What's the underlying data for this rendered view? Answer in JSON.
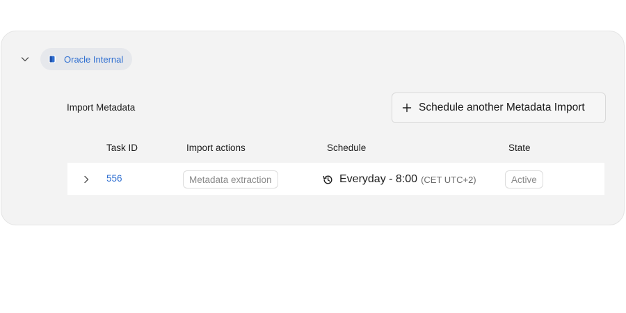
{
  "source": {
    "name": "Oracle Internal",
    "icon": "database-icon"
  },
  "section": {
    "title": "Import Metadata",
    "schedule_button": "Schedule another Metadata Import"
  },
  "table": {
    "columns": [
      "Task ID",
      "Import actions",
      "Schedule",
      "State"
    ],
    "rows": [
      {
        "task_id": "556",
        "action": "Metadata extraction",
        "schedule": "Everyday - 8:00",
        "timezone": "(CET UTC+2)",
        "state": "Active"
      }
    ]
  },
  "colors": {
    "accent": "#2f6fd1",
    "panel_bg": "#f3f3f3",
    "chip_bg": "#e6e8ec"
  }
}
